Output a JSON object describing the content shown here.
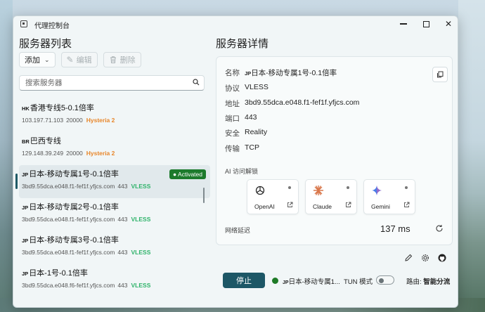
{
  "window": {
    "title": "代理控制台"
  },
  "left": {
    "title": "服务器列表",
    "toolbar": {
      "add": "添加",
      "edit": "编辑",
      "delete": "删除"
    },
    "search": {
      "placeholder": "搜索服务器",
      "value": ""
    }
  },
  "servers": [
    {
      "cc": "HK",
      "name": "香港专线5-0.1倍率",
      "addr": "103.197.71.103",
      "port": "20000",
      "proto": "Hysteria 2",
      "active": false
    },
    {
      "cc": "BR",
      "name": "巴西专线",
      "addr": "129.148.39.249",
      "port": "20000",
      "proto": "Hysteria 2",
      "active": false
    },
    {
      "cc": "JP",
      "name": "日本-移动专属1号-0.1倍率",
      "addr": "3bd9.55dca.e048.f1-fef1f.yfjcs.com",
      "port": "443",
      "proto": "VLESS",
      "active": true
    },
    {
      "cc": "JP",
      "name": "日本-移动专属2号-0.1倍率",
      "addr": "3bd9.55dca.e048.f1-fef1f.yfjcs.com",
      "port": "443",
      "proto": "VLESS",
      "active": false
    },
    {
      "cc": "JP",
      "name": "日本-移动专属3号-0.1倍率",
      "addr": "3bd9.55dca.e048.f1-fef1f.yfjcs.com",
      "port": "443",
      "proto": "VLESS",
      "active": false
    },
    {
      "cc": "JP",
      "name": "日本-1号-0.1倍率",
      "addr": "3bd9.55dca.e048.f6-fef1f.yfjcs.com",
      "port": "443",
      "proto": "VLESS",
      "active": false
    }
  ],
  "active_badge": "● Activated",
  "detail": {
    "title": "服务器详情",
    "name_label": "名称",
    "name_cc": "JP",
    "name_value": "日本-移动专属1号-0.1倍率",
    "protocol_label": "协议",
    "protocol_value": "VLESS",
    "address_label": "地址",
    "address_value": "3bd9.55dca.e048.f1-fef1f.yfjcs.com",
    "port_label": "端口",
    "port_value": "443",
    "security_label": "安全",
    "security_value": "Reality",
    "transport_label": "传输",
    "transport_value": "TCP",
    "ai_section": "AI 访问解锁",
    "ai": [
      {
        "name": "OpenAI"
      },
      {
        "name": "Claude"
      },
      {
        "name": "Gemini"
      }
    ],
    "latency_label": "网络延迟",
    "latency_value": "137 ms"
  },
  "statusbar": {
    "stop": "停止",
    "current_cc": "JP",
    "current_name": "日本-移动专属1...",
    "tun_label": "TUN 模式",
    "route_label": "路由:",
    "route_value": "智能分流"
  },
  "colors": {
    "accent": "#1d5766",
    "active": "#1c7a2c",
    "hysteria": "#e8862a",
    "vless": "#2fb36a"
  }
}
